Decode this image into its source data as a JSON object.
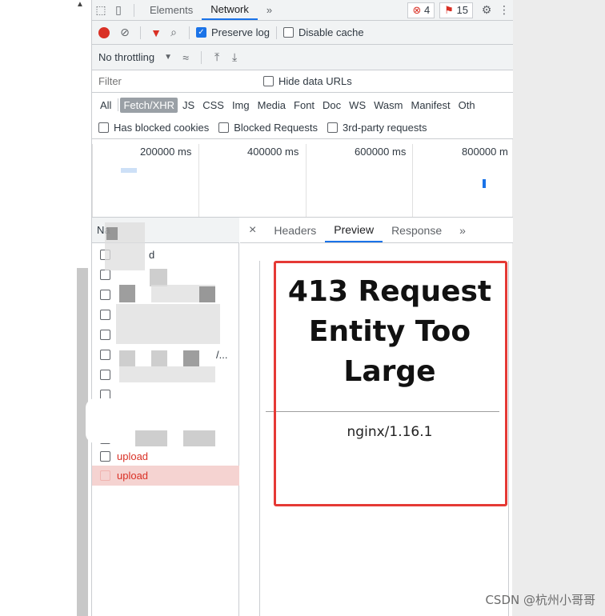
{
  "toolbar": {
    "tabs": [
      "Elements",
      "Network"
    ],
    "more": "»",
    "error_count": "4",
    "warning_count": "15"
  },
  "controls": {
    "preserve_log": "Preserve log",
    "disable_cache": "Disable cache",
    "throttling": "No throttling"
  },
  "filter": {
    "placeholder": "Filter",
    "hide_data_urls": "Hide data URLs",
    "types": [
      "All",
      "Fetch/XHR",
      "JS",
      "CSS",
      "Img",
      "Media",
      "Font",
      "Doc",
      "WS",
      "Wasm",
      "Manifest",
      "Oth"
    ],
    "active_type": "Fetch/XHR",
    "has_blocked_cookies": "Has blocked cookies",
    "blocked_requests": "Blocked Requests",
    "third_party": "3rd-party requests"
  },
  "timeline": {
    "ticks": [
      "200000 ms",
      "400000 ms",
      "600000 ms",
      "800000 m"
    ]
  },
  "requests": {
    "header": "Na",
    "rows": [
      {
        "name": "d"
      },
      {
        "name": ""
      },
      {
        "name": ""
      },
      {
        "name": ""
      },
      {
        "name": ""
      },
      {
        "name": "/..."
      },
      {
        "name": ""
      },
      {
        "name": ""
      },
      {
        "name": ""
      },
      {
        "name": "upload"
      },
      {
        "name": "upload"
      }
    ]
  },
  "detail": {
    "close": "×",
    "tabs": [
      "Headers",
      "Preview",
      "Response"
    ],
    "active_tab": "Preview",
    "more": "»"
  },
  "preview": {
    "title_lines": [
      "413 Request",
      "Entity Too",
      "Large"
    ],
    "server": "nginx/1.16.1"
  },
  "watermark": "CSDN @杭州小哥哥",
  "colors": {
    "accent": "#1a73e8",
    "error": "#d93025",
    "highlight_box": "#e53935",
    "selected_row": "#f5d3d1"
  }
}
